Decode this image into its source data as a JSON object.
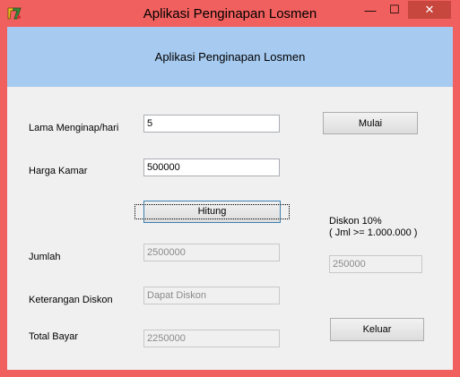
{
  "window": {
    "title": "Aplikasi Penginapan Losmen",
    "controls": {
      "minimize": "—",
      "maximize": "☐",
      "close": "✕"
    }
  },
  "banner": {
    "text": "Aplikasi Penginapan Losmen"
  },
  "form": {
    "lama_label": "Lama Menginap/hari",
    "lama_value": "5",
    "harga_label": "Harga Kamar",
    "harga_value": "500000",
    "jumlah_label": "Jumlah",
    "jumlah_value": "2500000",
    "keterangan_label": "Keterangan Diskon",
    "keterangan_value": "Dapat Diskon",
    "total_label": "Total Bayar",
    "total_value": "2250000",
    "diskon_label_line1": "Diskon 10%",
    "diskon_label_line2": "( Jml >= 1.000.000 )",
    "diskon_value": "250000"
  },
  "buttons": {
    "mulai": "Mulai",
    "hitung": "Hitung",
    "keluar": "Keluar"
  },
  "colors": {
    "titlebar": "#f0605e",
    "banner": "#a6caf0",
    "close": "#c7463e"
  }
}
